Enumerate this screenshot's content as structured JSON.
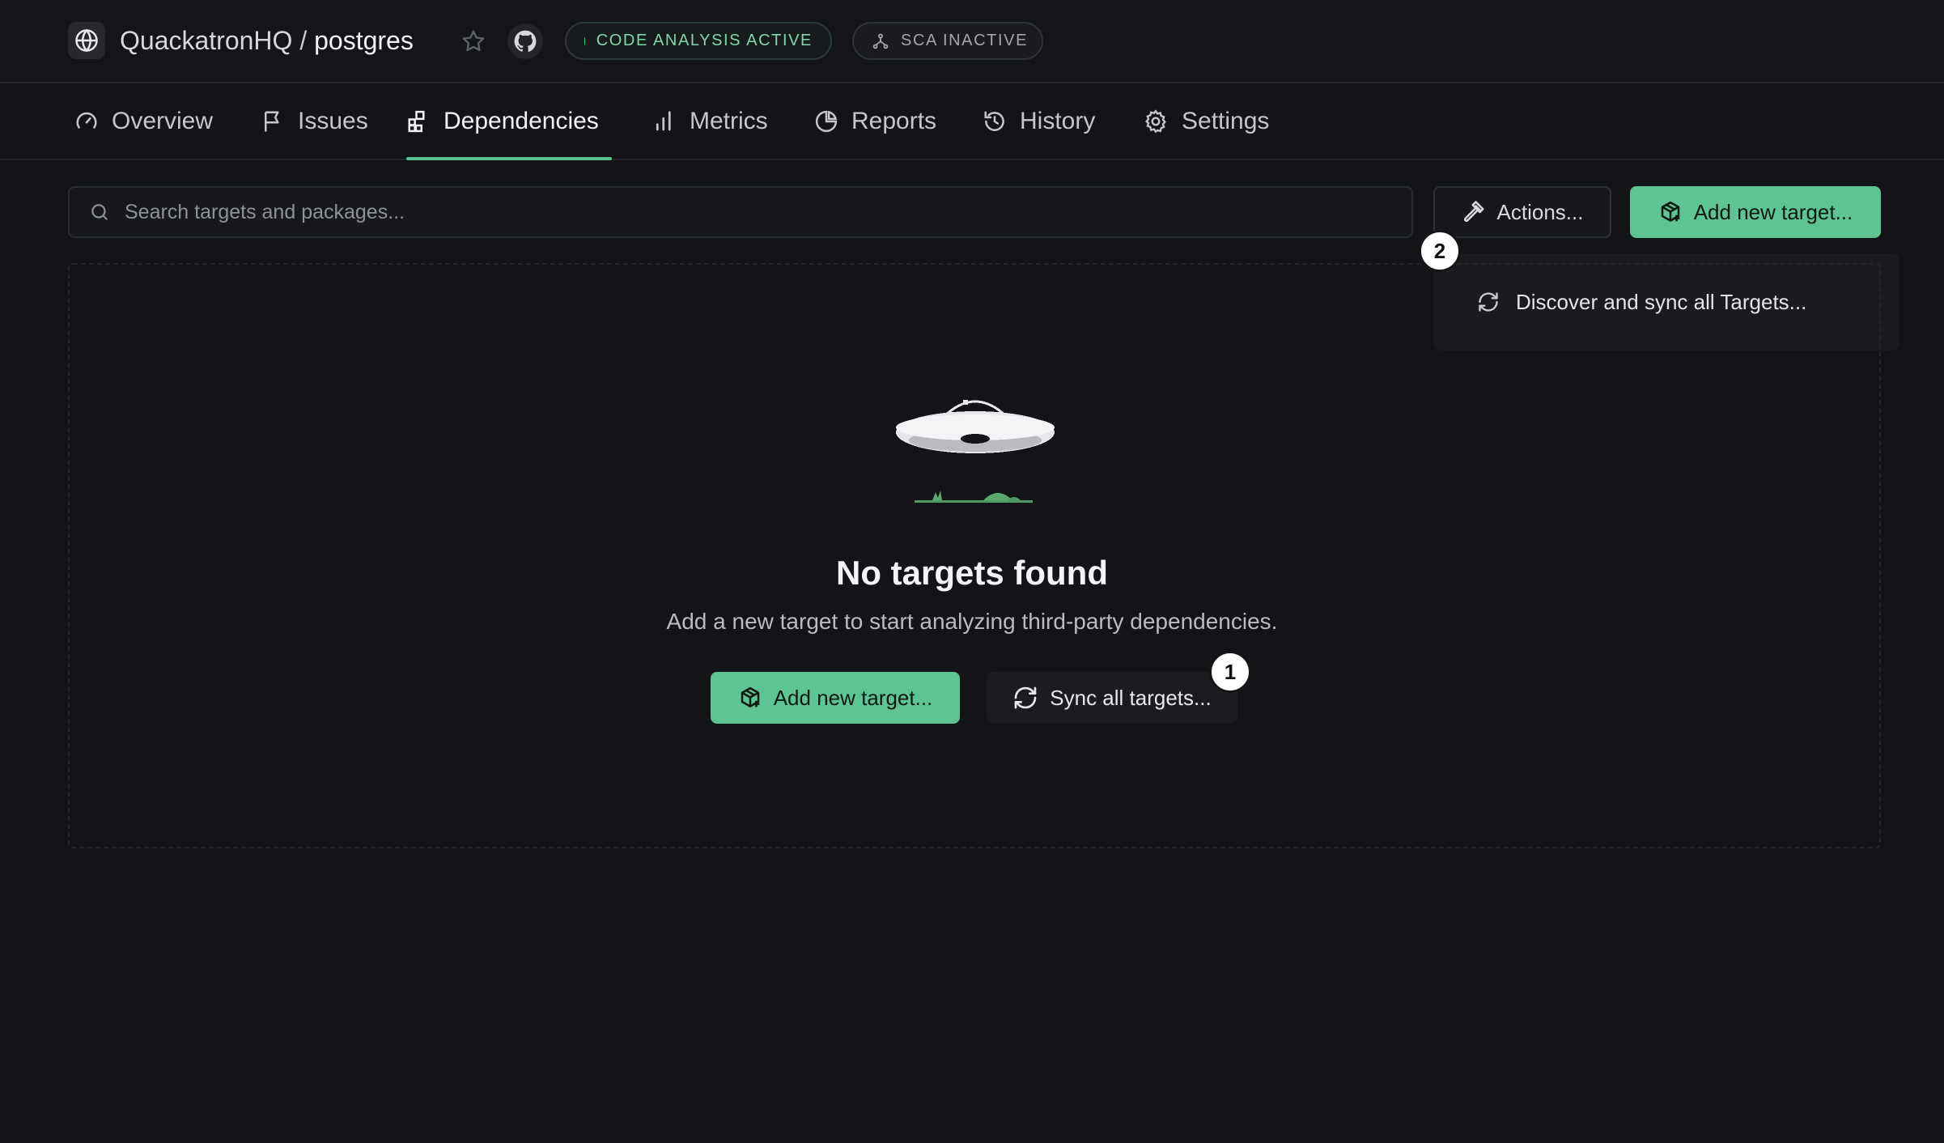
{
  "header": {
    "org": "QuackatronHQ",
    "separator": "/",
    "repo": "postgres",
    "badges": {
      "code_analysis": "CODE ANALYSIS ACTIVE",
      "sca": "SCA INACTIVE"
    }
  },
  "tabs": [
    {
      "label": "Overview",
      "icon": "gauge-icon"
    },
    {
      "label": "Issues",
      "icon": "flag-icon"
    },
    {
      "label": "Dependencies",
      "icon": "blocks-icon",
      "active": true
    },
    {
      "label": "Metrics",
      "icon": "bar-chart-icon"
    },
    {
      "label": "Reports",
      "icon": "pie-chart-icon"
    },
    {
      "label": "History",
      "icon": "history-icon"
    },
    {
      "label": "Settings",
      "icon": "gear-icon"
    }
  ],
  "toolbar": {
    "search_placeholder": "Search targets and packages...",
    "actions_label": "Actions...",
    "add_target_label": "Add new target..."
  },
  "dropdown": {
    "items": [
      {
        "label": "Discover and sync all Targets...",
        "icon": "refresh-icon"
      }
    ]
  },
  "empty_state": {
    "title": "No targets found",
    "subtitle": "Add a new target to start analyzing third-party dependencies.",
    "add_button": "Add new target...",
    "sync_button": "Sync all targets..."
  },
  "markers": {
    "one": "1",
    "two": "2"
  },
  "colors": {
    "background": "#131418",
    "accent_green": "#5fc493",
    "active_tab_underline": "#58c08f"
  }
}
